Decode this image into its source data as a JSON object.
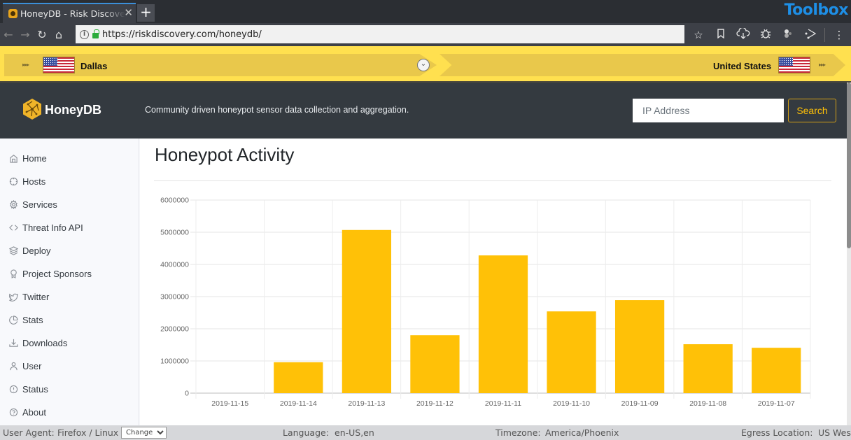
{
  "browser": {
    "tab_title": "HoneyDB - Risk Discovery",
    "new_tab_label": "+",
    "toolbox_label": "Toolbox",
    "url": "https://riskdiscovery.com/honeydb/",
    "nav_icons": [
      "back-icon",
      "forward-icon",
      "reload-icon",
      "home-icon"
    ],
    "toolbar_icons": [
      "bookmark-star-icon",
      "bookmarks-icon",
      "cloud-download-icon",
      "bug-icon",
      "extension-icon",
      "share-icon",
      "menu-icon"
    ]
  },
  "banner": {
    "left_location": "Dallas",
    "right_location": "United States",
    "arrows": "▸▸▸"
  },
  "header": {
    "brand": "HoneyDB",
    "tagline": "Community driven honeypot sensor data collection and aggregation.",
    "search_placeholder": "IP Address",
    "search_value": "",
    "search_button": "Search"
  },
  "sidebar": {
    "items": [
      {
        "label": "Home",
        "icon": "home-icon"
      },
      {
        "label": "Hosts",
        "icon": "crosshair-icon"
      },
      {
        "label": "Services",
        "icon": "gear-icon"
      },
      {
        "label": "Threat Info API",
        "icon": "code-icon"
      },
      {
        "label": "Deploy",
        "icon": "layers-icon"
      },
      {
        "label": "Project Sponsors",
        "icon": "award-icon"
      },
      {
        "label": "Twitter",
        "icon": "twitter-icon"
      },
      {
        "label": "Stats",
        "icon": "pie-chart-icon"
      },
      {
        "label": "Downloads",
        "icon": "download-icon"
      },
      {
        "label": "User",
        "icon": "user-icon"
      },
      {
        "label": "Status",
        "icon": "alert-circle-icon"
      },
      {
        "label": "About",
        "icon": "help-circle-icon"
      }
    ]
  },
  "main": {
    "title": "Honeypot Activity"
  },
  "chart_data": {
    "type": "bar",
    "title": "",
    "xlabel": "",
    "ylabel": "",
    "categories": [
      "2019-11-15",
      "2019-11-14",
      "2019-11-13",
      "2019-11-12",
      "2019-11-11",
      "2019-11-10",
      "2019-11-09",
      "2019-11-08",
      "2019-11-07"
    ],
    "values": [
      0,
      960000,
      5070000,
      1800000,
      4280000,
      2540000,
      2890000,
      1520000,
      1410000
    ],
    "ylim": [
      0,
      6000000
    ],
    "yticks": [
      "0",
      "1000000",
      "2000000",
      "3000000",
      "4000000",
      "5000000",
      "6000000"
    ],
    "ytick_values": [
      0,
      1000000,
      2000000,
      3000000,
      4000000,
      5000000,
      6000000
    ],
    "grid": true,
    "legend": "none",
    "bar_color": "#ffc107"
  },
  "statusbar": {
    "user_agent_label": "User Agent:",
    "user_agent_value": "Firefox / Linux",
    "change_option": "Change",
    "language_label": "Language:",
    "language_value": "en-US,en",
    "timezone_label": "Timezone:",
    "timezone_value": "America/Phoenix",
    "egress_label": "Egress Location:",
    "egress_value": "US West"
  }
}
